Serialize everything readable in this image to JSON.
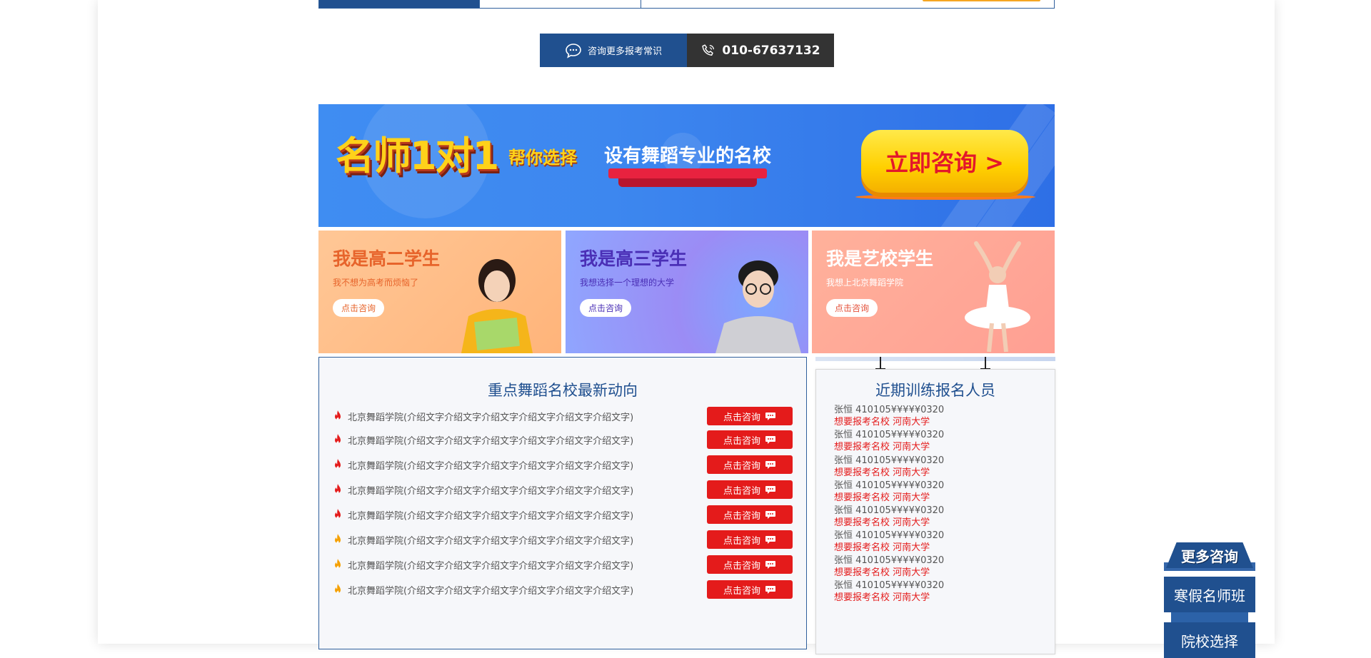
{
  "consult_bar": {
    "left_label": "咨询更多报考常识",
    "phone": "010-67637132"
  },
  "banner": {
    "title": "名师1对1",
    "subtitle": "帮你选择",
    "school_text": "设有舞蹈专业的名校",
    "cta_label": "立即咨询 >"
  },
  "cards": [
    {
      "title": "我是高二学生",
      "subtitle": "我不想为高考而烦恼了",
      "button": "点击咨询"
    },
    {
      "title": "我是高三学生",
      "subtitle": "我想选择一个理想的大学",
      "button": "点击咨询"
    },
    {
      "title": "我是艺校学生",
      "subtitle": "我想上北京舞蹈学院",
      "button": "点击咨询"
    }
  ],
  "news": {
    "title": "重点舞蹈名校最新动向",
    "items": [
      {
        "text": "北京舞蹈学院(介绍文字介绍文字介绍文字介绍文字介绍文字介绍文字)",
        "button": "点击咨询",
        "fire_color": "#e41b1b"
      },
      {
        "text": "北京舞蹈学院(介绍文字介绍文字介绍文字介绍文字介绍文字介绍文字)",
        "button": "点击咨询",
        "fire_color": "#e41b1b"
      },
      {
        "text": "北京舞蹈学院(介绍文字介绍文字介绍文字介绍文字介绍文字介绍文字)",
        "button": "点击咨询",
        "fire_color": "#e41b1b"
      },
      {
        "text": "北京舞蹈学院(介绍文字介绍文字介绍文字介绍文字介绍文字介绍文字)",
        "button": "点击咨询",
        "fire_color": "#e41b1b"
      },
      {
        "text": "北京舞蹈学院(介绍文字介绍文字介绍文字介绍文字介绍文字介绍文字)",
        "button": "点击咨询",
        "fire_color": "#e41b1b"
      },
      {
        "text": "北京舞蹈学院(介绍文字介绍文字介绍文字介绍文字介绍文字介绍文字)",
        "button": "点击咨询",
        "fire_color": "#f5a000"
      },
      {
        "text": "北京舞蹈学院(介绍文字介绍文字介绍文字介绍文字介绍文字介绍文字)",
        "button": "点击咨询",
        "fire_color": "#f5a000"
      },
      {
        "text": "北京舞蹈学院(介绍文字介绍文字介绍文字介绍文字介绍文字介绍文字)",
        "button": "点击咨询",
        "fire_color": "#f5a000"
      }
    ]
  },
  "signup": {
    "title": "近期训练报名人员",
    "items": [
      {
        "line1": "张恒  410105¥¥¥¥¥0320",
        "line2": "想要报考名校 河南大学"
      },
      {
        "line1": "张恒  410105¥¥¥¥¥0320",
        "line2": "想要报考名校 河南大学"
      },
      {
        "line1": "张恒  410105¥¥¥¥¥0320",
        "line2": "想要报考名校 河南大学"
      },
      {
        "line1": "张恒  410105¥¥¥¥¥0320",
        "line2": "想要报考名校 河南大学"
      },
      {
        "line1": "张恒  410105¥¥¥¥¥0320",
        "line2": "想要报考名校 河南大学"
      },
      {
        "line1": "张恒  410105¥¥¥¥¥0320",
        "line2": "想要报考名校 河南大学"
      },
      {
        "line1": "张恒  410105¥¥¥¥¥0320",
        "line2": "想要报考名校 河南大学"
      },
      {
        "line1": "张恒  410105¥¥¥¥¥0320",
        "line2": "想要报考名校 河南大学"
      }
    ]
  },
  "side_panel": {
    "header": "更多咨询",
    "buttons": [
      "寒假名师班",
      "院校选择"
    ]
  },
  "colors": {
    "primary": "#20508f",
    "accent_red": "#e41b1b",
    "dark": "#333333"
  }
}
